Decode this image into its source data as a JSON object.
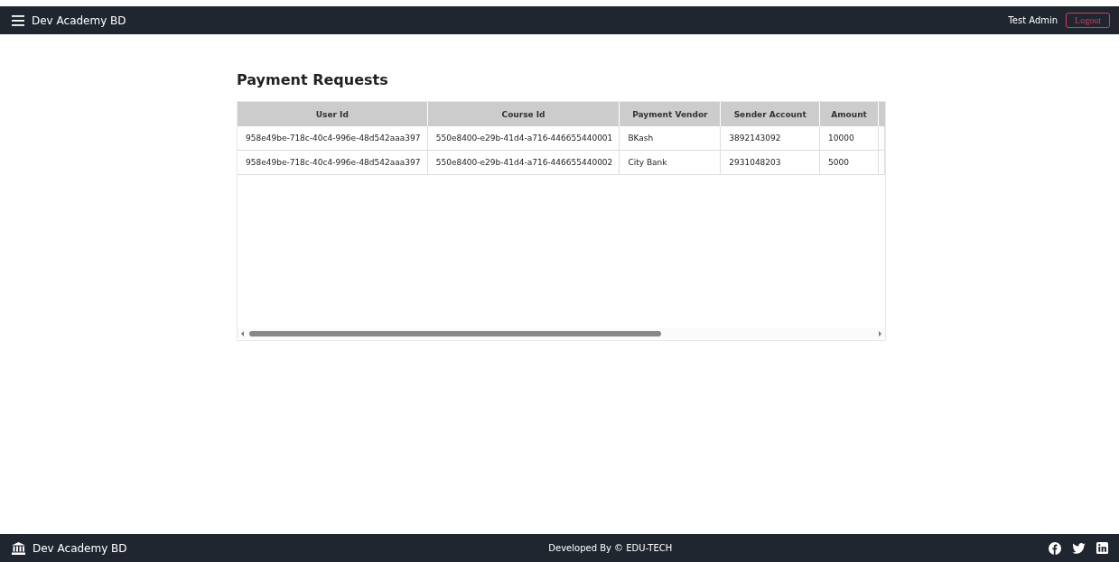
{
  "navbar": {
    "brand": "Dev Academy BD",
    "user": "Test Admin",
    "logout": "Logout"
  },
  "page": {
    "title": "Payment Requests"
  },
  "table": {
    "columns": [
      "User Id",
      "Course Id",
      "Payment Vendor",
      "Sender Account",
      "Amount"
    ],
    "rows": [
      [
        "958e49be-718c-40c4-996e-48d542aaa397",
        "550e8400-e29b-41d4-a716-446655440001",
        "BKash",
        "3892143092",
        "10000"
      ],
      [
        "958e49be-718c-40c4-996e-48d542aaa397",
        "550e8400-e29b-41d4-a716-446655440002",
        "City Bank",
        "2931048203",
        "5000"
      ]
    ]
  },
  "footer": {
    "brand": "Dev Academy BD",
    "credit": "Developed By  © EDU-TECH"
  }
}
